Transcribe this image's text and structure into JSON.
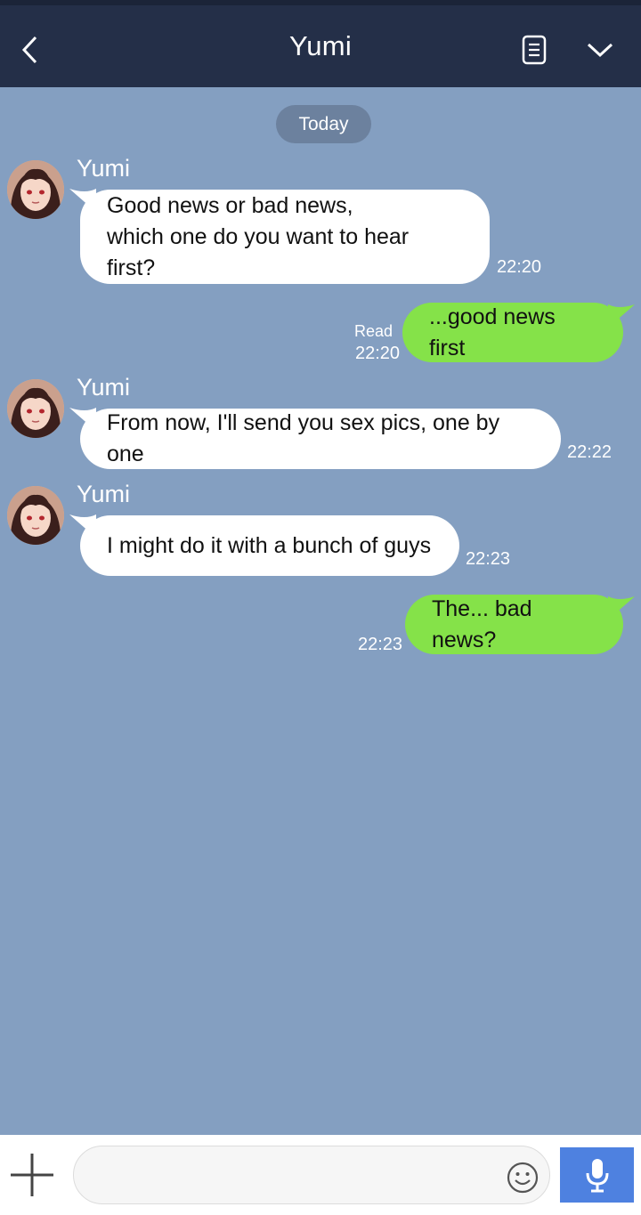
{
  "header": {
    "title": "Yumi",
    "back_icon": "chevron-left-icon",
    "notes_icon": "document-icon",
    "menu_icon": "chevron-down-icon"
  },
  "chat": {
    "date_divider": "Today",
    "messages": [
      {
        "direction": "incoming",
        "sender": "Yumi",
        "lines": [
          "Good news or bad news,",
          "which one do you want to hear first?"
        ],
        "time": "22:20"
      },
      {
        "direction": "outgoing",
        "text": "...good news first",
        "read_label": "Read",
        "time": "22:20"
      },
      {
        "direction": "incoming",
        "sender": "Yumi",
        "text": "From now, I'll send you sex pics, one by one",
        "time": "22:22"
      },
      {
        "direction": "incoming",
        "sender": "Yumi",
        "text": "I might do it with a bunch of guys",
        "time": "22:23"
      },
      {
        "direction": "outgoing",
        "text": "The... bad news?",
        "time": "22:23"
      }
    ]
  },
  "footer": {
    "input_value": "",
    "input_placeholder": "",
    "plus_icon": "plus-icon",
    "emoji_icon": "smiley-icon",
    "mic_icon": "microphone-icon"
  },
  "colors": {
    "header_bg": "#242f48",
    "chat_bg": "#849fc1",
    "incoming_bubble": "#ffffff",
    "outgoing_bubble": "#85e249",
    "mic_button": "#4e81e0",
    "date_pill": "#6c819e"
  }
}
